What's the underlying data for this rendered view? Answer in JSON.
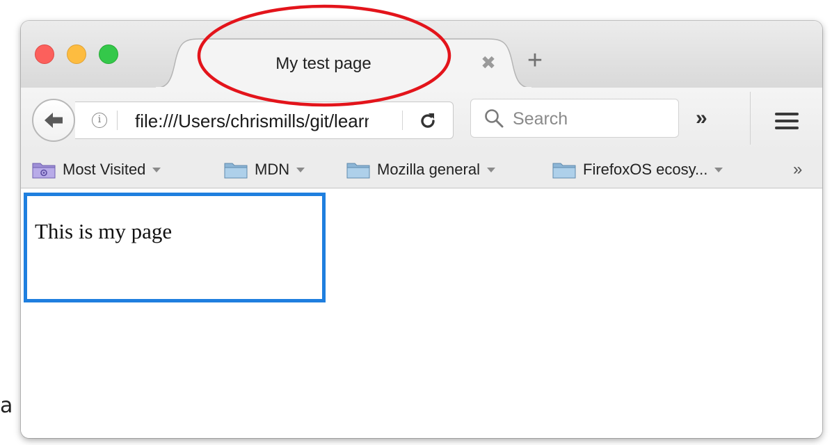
{
  "window": {
    "tab": {
      "title": "My test page",
      "close_glyph": "✖"
    },
    "new_tab_glyph": "+",
    "url": "file:///Users/chrismills/git/learning-area/html/introduction-to-html/getting-started/index.html",
    "search": {
      "placeholder": "Search"
    },
    "overflow_glyph": "»",
    "bookmarks": [
      {
        "label": "Most Visited",
        "icon": "smart-folder-icon",
        "has_dropdown": true
      },
      {
        "label": "MDN",
        "icon": "folder-icon",
        "has_dropdown": true
      },
      {
        "label": "Mozilla general",
        "icon": "folder-icon",
        "has_dropdown": true
      },
      {
        "label": "FirefoxOS ecosy...",
        "icon": "folder-icon",
        "has_dropdown": true
      }
    ],
    "bookmarks_overflow_glyph": "»"
  },
  "page": {
    "text": "This is my page"
  },
  "stray_text": "a",
  "colors": {
    "annotation_ellipse": "#e3141b",
    "focus_outline": "#1f7fdf",
    "traffic_close": "#fc605c",
    "traffic_minimize": "#fdbc40",
    "traffic_maximize": "#34c84a"
  }
}
